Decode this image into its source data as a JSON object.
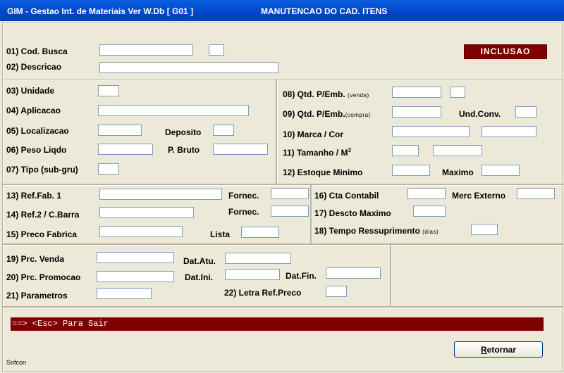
{
  "window": {
    "app_title": "GIM - Gestao Int. de Materiais  Ver W.Db   [ G01 ]",
    "screen_title": "MANUTENCAO DO CAD. ITENS"
  },
  "mode_badge": "INCLUSAO",
  "fields": {
    "f01": "01)  Cod. Busca",
    "f02": "02)  Descricao",
    "f03": "03)  Unidade",
    "f04": "04)  Aplicacao",
    "f05": "05)  Localizacao",
    "f05b": "Deposito",
    "f06": "06)  Peso Liqdo",
    "f06b": "P. Bruto",
    "f07": "07)  Tipo (sub-gru)",
    "f08": "08)  Qtd. P/Emb.",
    "f08_note": "(venda)",
    "f09": "09)  Qtd. P/Emb.",
    "f09_note": "(compra)",
    "f09b": "Und.Conv.",
    "f10": "10)  Marca / Cor",
    "f11": "11)  Tamanho / M",
    "f11_sup": "3",
    "f12": "12)  Estoque Minimo",
    "f12b": "Maximo",
    "f13": "13)  Ref.Fab. 1",
    "f13b": "Fornec.",
    "f14": "14)  Ref.2 / C.Barra",
    "f14b": "Fornec.",
    "f15": "15)  Preco Fabrica",
    "f15b": "Lista",
    "f16": "16)  Cta Contabil",
    "f16b": "Merc Externo",
    "f17": "17)  Descto Maximo",
    "f18": "18)  Tempo Ressuprimento",
    "f18_note": "(dias)",
    "f19": "19)  Prc. Venda",
    "f19b": "Dat.Atu.",
    "f20": "20)  Prc. Promocao",
    "f20b": "Dat.Ini.",
    "f20c": "Dat.Fin.",
    "f21": "21)  Parametros",
    "f22": "22)  Letra Ref.Preco"
  },
  "exit_hint": "==> <Esc> Para Sair",
  "buttons": {
    "retornar": "Retornar"
  },
  "footer": "Sofcon",
  "colors": {
    "titlebar": "#0046c8",
    "badge": "#800000",
    "background": "#ece9d8"
  }
}
